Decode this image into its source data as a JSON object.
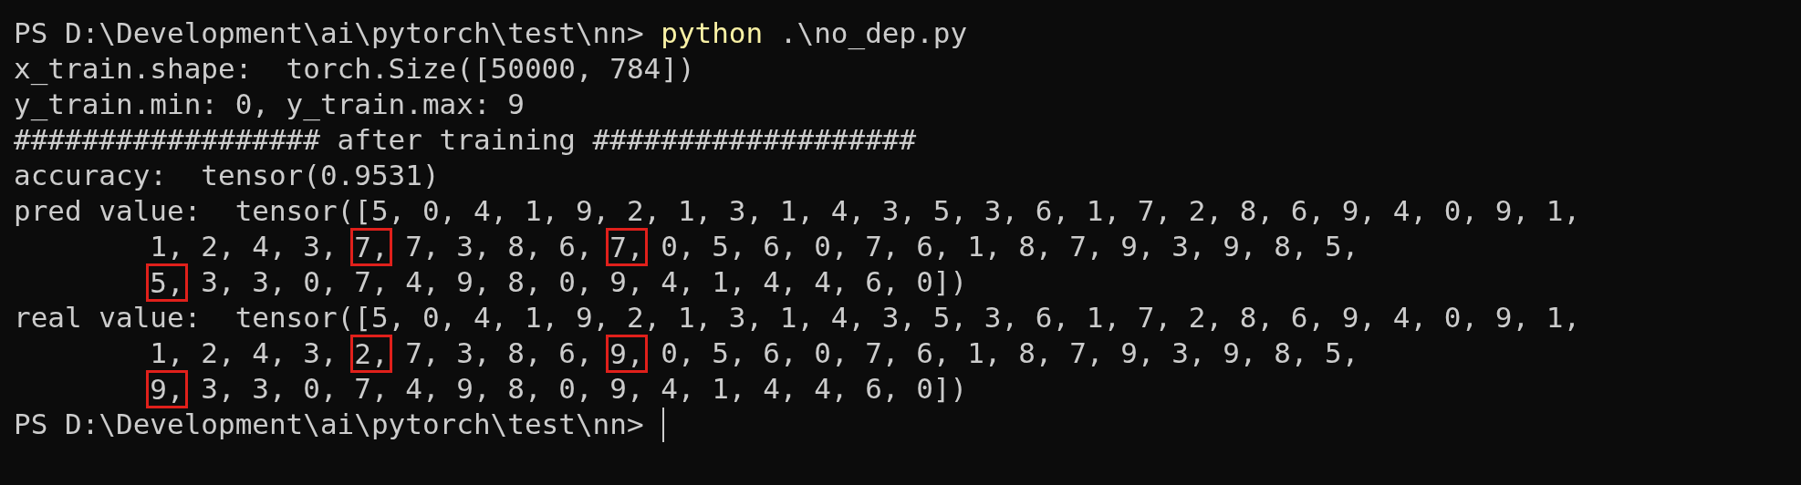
{
  "terminal": {
    "lines": [
      [
        {
          "kind": "plain",
          "text": "PS D:\\Development\\ai\\pytorch\\test\\nn> "
        },
        {
          "kind": "command",
          "text": "python"
        },
        {
          "kind": "plain",
          "text": " .\\no_dep.py"
        }
      ],
      [
        {
          "kind": "plain",
          "text": "x_train.shape:  torch.Size([50000, 784])"
        }
      ],
      [
        {
          "kind": "plain",
          "text": "y_train.min: 0, y_train.max: 9"
        }
      ],
      [
        {
          "kind": "plain",
          "text": "################## after training ###################"
        }
      ],
      [
        {
          "kind": "plain",
          "text": "accuracy:  tensor(0.9531)"
        }
      ],
      [
        {
          "kind": "plain",
          "text": "pred value:  tensor([5, 0, 4, 1, 9, 2, 1, 3, 1, 4, 3, 5, 3, 6, 1, 7, 2, 8, 6, 9, 4, 0, 9, 1,"
        }
      ],
      [
        {
          "kind": "plain",
          "text": "        1, 2, 4, 3, "
        },
        {
          "kind": "boxed",
          "text": "7,"
        },
        {
          "kind": "plain",
          "text": " 7, 3, 8, 6, "
        },
        {
          "kind": "boxed",
          "text": "7,"
        },
        {
          "kind": "plain",
          "text": " 0, 5, 6, 0, 7, 6, 1, 8, 7, 9, 3, 9, 8, 5,"
        }
      ],
      [
        {
          "kind": "indent"
        },
        {
          "kind": "boxed",
          "text": "5,"
        },
        {
          "kind": "plain",
          "text": " 3, 3, 0, 7, 4, 9, 8, 0, 9, 4, 1, 4, 4, 6, 0])"
        }
      ],
      [
        {
          "kind": "plain",
          "text": "real value:  tensor([5, 0, 4, 1, 9, 2, 1, 3, 1, 4, 3, 5, 3, 6, 1, 7, 2, 8, 6, 9, 4, 0, 9, 1,"
        }
      ],
      [
        {
          "kind": "plain",
          "text": "        1, 2, 4, 3, "
        },
        {
          "kind": "boxed",
          "text": "2,"
        },
        {
          "kind": "plain",
          "text": " 7, 3, 8, 6, "
        },
        {
          "kind": "boxed",
          "text": "9,"
        },
        {
          "kind": "plain",
          "text": " 0, 5, 6, 0, 7, 6, 1, 8, 7, 9, 3, 9, 8, 5,"
        }
      ],
      [
        {
          "kind": "indent"
        },
        {
          "kind": "boxed",
          "text": "9,"
        },
        {
          "kind": "plain",
          "text": " 3, 3, 0, 7, 4, 9, 8, 0, 9, 4, 1, 4, 4, 6, 0])"
        }
      ],
      [
        {
          "kind": "plain",
          "text": "PS D:\\Development\\ai\\pytorch\\test\\nn> "
        }
      ]
    ]
  }
}
